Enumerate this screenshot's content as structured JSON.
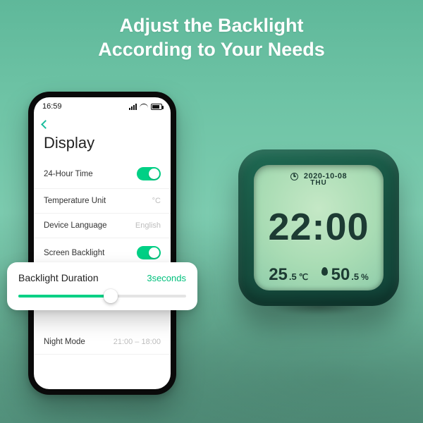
{
  "headline": {
    "line1": "Adjust the Backlight",
    "line2": "According to Your Needs"
  },
  "phone": {
    "status_time": "16:59",
    "back_icon": "chevron-left",
    "page_title": "Display",
    "rows": {
      "time_format": {
        "label": "24-Hour Time",
        "toggle": true
      },
      "temp_unit": {
        "label": "Temperature Unit",
        "value": "°C"
      },
      "language": {
        "label": "Device Language",
        "value": "English"
      },
      "backlight": {
        "label": "Screen Backlight",
        "toggle": true
      },
      "night_mode": {
        "label": "Night Mode",
        "value": "21:00 – 18:00"
      }
    }
  },
  "popout": {
    "label": "Backlight Duration",
    "value": "3seconds",
    "slider_percent": 55
  },
  "clock": {
    "date": "2020-10-08",
    "day": "THU",
    "time": "22:00",
    "temperature": {
      "int": "25",
      "dec": ".5",
      "unit": "℃"
    },
    "humidity": {
      "int": "50",
      "dec": ".5",
      "unit": "%"
    }
  }
}
